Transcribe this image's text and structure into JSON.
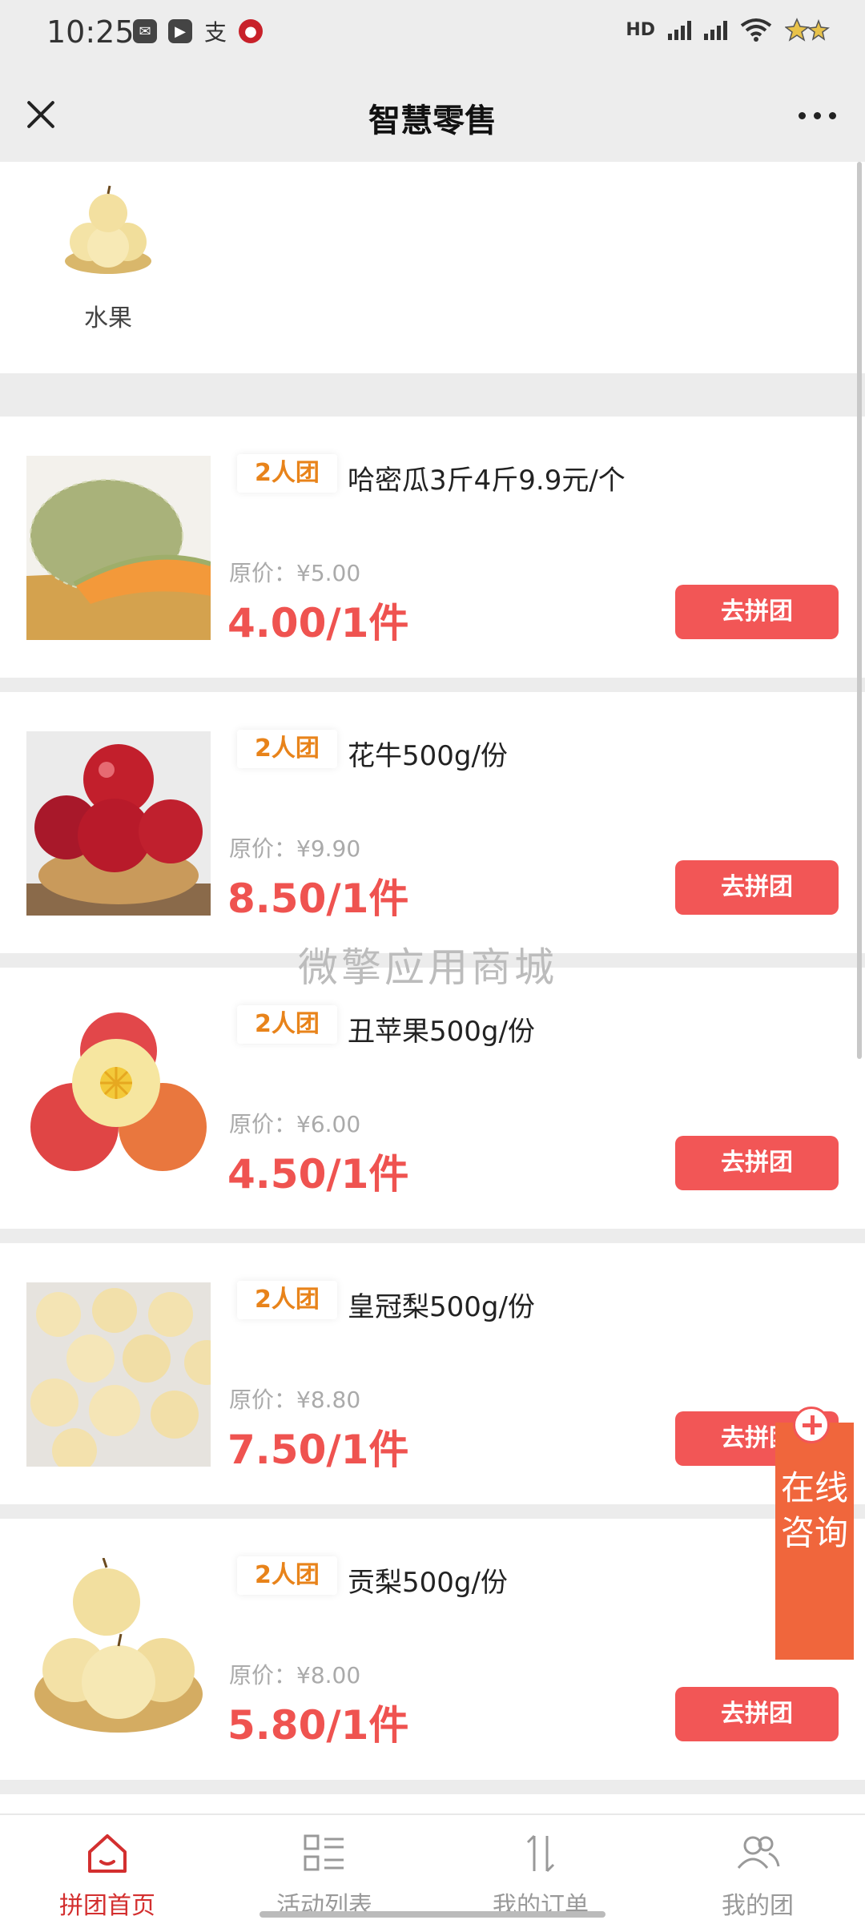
{
  "status": {
    "time": "10:25"
  },
  "header": {
    "title": "智慧零售"
  },
  "category": {
    "label": "水果"
  },
  "products": [
    {
      "badge": "2人团",
      "name": "哈密瓜3斤4斤9.9元/个",
      "orig": "原价：¥5.00",
      "price": "4.00/1件",
      "button": "去拼团"
    },
    {
      "badge": "2人团",
      "name": "花牛500g/份",
      "orig": "原价：¥9.90",
      "price": "8.50/1件",
      "button": "去拼团"
    },
    {
      "badge": "2人团",
      "name": "丑苹果500g/份",
      "orig": "原价：¥6.00",
      "price": "4.50/1件",
      "button": "去拼团"
    },
    {
      "badge": "2人团",
      "name": "皇冠梨500g/份",
      "orig": "原价：¥8.80",
      "price": "7.50/1件",
      "button": "去拼团"
    },
    {
      "badge": "2人团",
      "name": "贡梨500g/份",
      "orig": "原价：¥8.00",
      "price": "5.80/1件",
      "button": "去拼团"
    }
  ],
  "watermark": "微擎应用商城",
  "consult": {
    "label": "在线咨询"
  },
  "tabs": [
    {
      "label": "拼团首页",
      "icon": "home-icon",
      "active": true
    },
    {
      "label": "活动列表",
      "icon": "list-icon",
      "active": false
    },
    {
      "label": "我的订单",
      "icon": "sort-icon",
      "active": false
    },
    {
      "label": "我的团",
      "icon": "group-icon",
      "active": false
    }
  ],
  "colors": {
    "accent": "#f25656",
    "price": "#ef5350",
    "badge": "#e8831a",
    "tab_active": "#d32f2f"
  }
}
